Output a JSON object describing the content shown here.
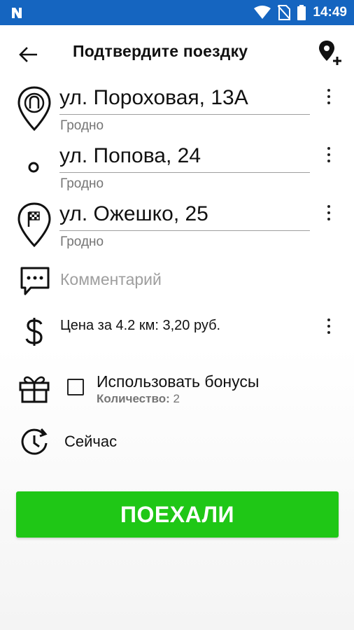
{
  "status_bar": {
    "time": "14:49"
  },
  "header": {
    "title": "Подтвердите поездку"
  },
  "route": [
    {
      "street": "ул. Пороховая, 13А",
      "city": "Гродно",
      "icon": "pickup-pin-icon"
    },
    {
      "street": "ул. Попова, 24",
      "city": "Гродно",
      "icon": "stop-dot-icon"
    },
    {
      "street": "ул. Ожешко, 25",
      "city": "Гродно",
      "icon": "finish-flag-pin-icon"
    }
  ],
  "comment": {
    "placeholder": "Комментарий"
  },
  "price": {
    "text": "Цена за 4.2 км: 3,20 руб."
  },
  "bonus": {
    "label": "Использовать бонусы",
    "count_label": "Количество:",
    "count_value": "2",
    "checked": false
  },
  "schedule": {
    "text": "Сейчас"
  },
  "action": {
    "go_label": "ПОЕХАЛИ"
  },
  "colors": {
    "status_bar": "#1565c0",
    "accent_green": "#1fc716",
    "secondary_text": "#757575"
  }
}
